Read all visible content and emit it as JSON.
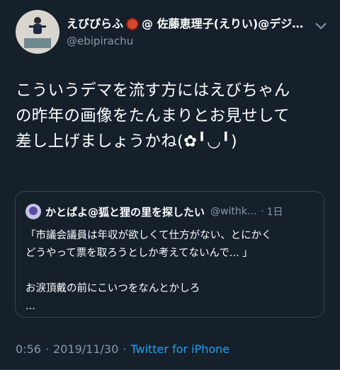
{
  "author": {
    "display_name_prefix": "えびぴらふ",
    "display_name_suffix": "@ 佐藤恵理子(えりい)@デジ…",
    "handle": "@ebipirachu"
  },
  "tweet": {
    "text": "こういうデマを流す方にはえびちゃん\nの昨年の画像をたんまりとお見せして\n差し上げましょうかね(✿╹◡╹)"
  },
  "quoted_tweet": {
    "author_name": "かとぱよ@狐と狸の里を探したい",
    "author_handle": "@withk...",
    "dot": "·",
    "time": "1日",
    "text": "「市議会議員は年収が欲しくて仕方がない、とにかく\nどうやって票を取ろうとしか考えてないんで... 」\n\nお涙頂戴の前にこいつをなんとかしろ\n..."
  },
  "footer": {
    "time": "0:56",
    "separator_1": "·",
    "date": "2019/11/30",
    "separator_2": "·",
    "source": "Twitter for iPhone"
  },
  "icons": [
    "avatar",
    "crab-emoji",
    "chevron-down-icon",
    "quoted-avatar"
  ],
  "colors": {
    "background": "#15202b",
    "secondary_text": "#8899a6",
    "link": "#1da1f2",
    "border": "#38444d"
  }
}
